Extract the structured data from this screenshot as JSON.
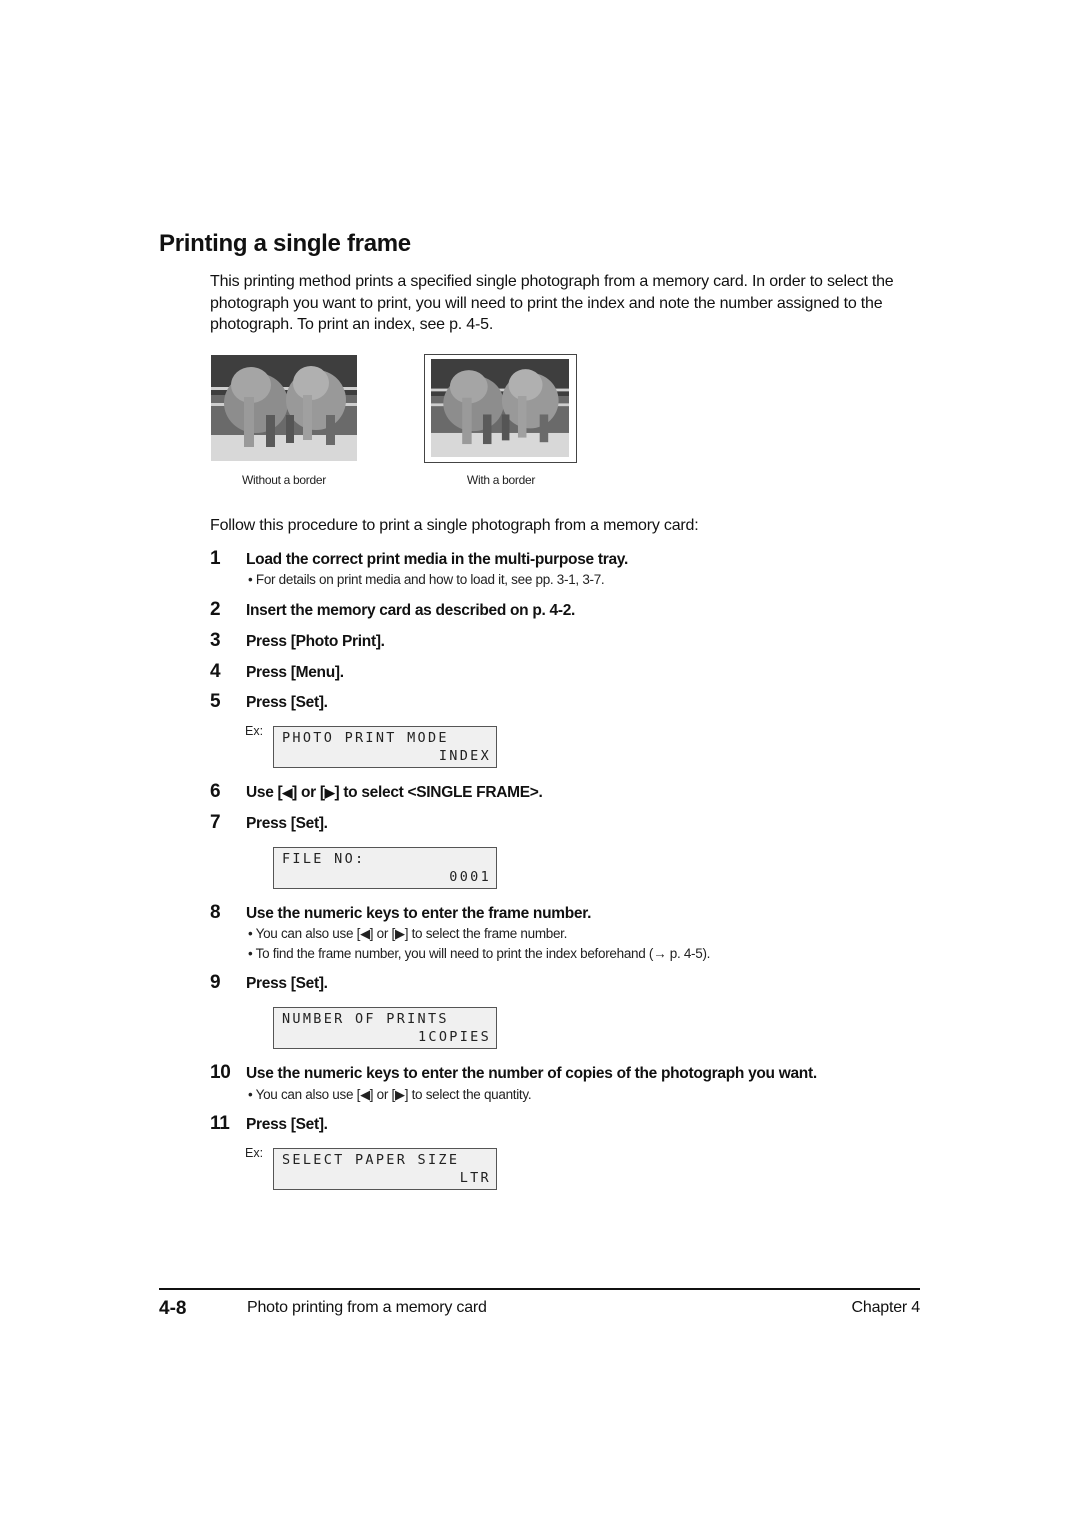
{
  "page": {
    "title": "Printing a single frame",
    "intro": "This printing method prints a specified single photograph from a memory card. In order to select the photograph you want to print, you will need to print the index and note the number assigned to the photograph. To print an index, see p. 4-5.",
    "figures": [
      {
        "caption": "Without a border",
        "image": "two-elephants-photo"
      },
      {
        "caption": "With a border",
        "image": "two-elephants-photo"
      }
    ],
    "follow": "Follow this procedure to print a single photograph from a memory card:",
    "ex_label": "Ex:",
    "steps": [
      {
        "num": "1",
        "text": "Load the correct print media in the multi-purpose tray.",
        "notes": [
          "• For details on print media and how to load it, see pp. 3-1, 3-7."
        ]
      },
      {
        "num": "2",
        "text": "Insert the memory card as described on p. 4-2."
      },
      {
        "num": "3",
        "text": "Press [Photo Print]."
      },
      {
        "num": "4",
        "text": "Press [Menu]."
      },
      {
        "num": "5",
        "text": "Press [Set].",
        "lcd": {
          "line1": "PHOTO PRINT MODE",
          "line2": "INDEX"
        }
      },
      {
        "num": "6",
        "text_a": "Use [",
        "left_icon": "◀",
        "text_b": "] or [",
        "right_icon": "▶",
        "text_c": "] to select <SINGLE FRAME>."
      },
      {
        "num": "7",
        "text": "Press [Set].",
        "lcd": {
          "line1": "FILE NO:",
          "line2": "0001"
        }
      },
      {
        "num": "8",
        "text": "Use the numeric keys to enter the frame number.",
        "notes": [
          {
            "a": "• You can also use [",
            "b": "] or [",
            "c": "] to select the frame number."
          },
          "• To find the frame number, you will need to print the index beforehand (→ p. 4-5)."
        ]
      },
      {
        "num": "9",
        "text": "Press [Set].",
        "lcd": {
          "line1": "NUMBER OF PRINTS",
          "line2": "1COPIES"
        }
      },
      {
        "num": "10",
        "text": "Use the numeric keys to enter the number of copies of the photograph you want.",
        "notes": [
          {
            "a": "• You can also use [",
            "b": "] or [",
            "c": "] to select the quantity."
          }
        ]
      },
      {
        "num": "11",
        "text": "Press [Set].",
        "lcd": {
          "line1": "SELECT PAPER SIZE",
          "line2": "LTR"
        }
      }
    ],
    "icons": {
      "left": "◀",
      "right": "▶"
    }
  },
  "footer": {
    "page_number": "4-8",
    "section": "Photo printing from a memory card",
    "chapter": "Chapter 4"
  }
}
